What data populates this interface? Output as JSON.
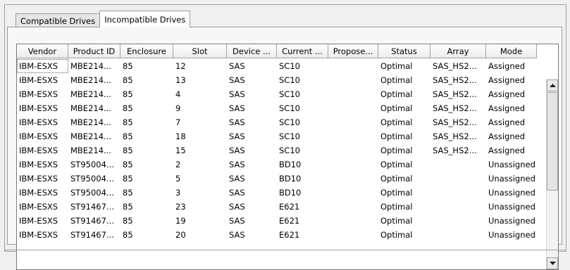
{
  "tabs": [
    {
      "label": "Compatible Drives",
      "active": false
    },
    {
      "label": "Incompatible Drives",
      "active": true
    }
  ],
  "table": {
    "columns": [
      "Vendor",
      "Product ID",
      "Enclosure",
      "Slot",
      "Device ...",
      "Current ...",
      "Propose...",
      "Status",
      "Array",
      "Mode"
    ],
    "rows": [
      [
        "IBM-ESXS",
        "MBE214...",
        "85",
        "12",
        "SAS",
        "SC10",
        "",
        "Optimal",
        "SAS_HS2...",
        "Assigned"
      ],
      [
        "IBM-ESXS",
        "MBE214...",
        "85",
        "13",
        "SAS",
        "SC10",
        "",
        "Optimal",
        "SAS_HS2...",
        "Assigned"
      ],
      [
        "IBM-ESXS",
        "MBE214...",
        "85",
        "4",
        "SAS",
        "SC10",
        "",
        "Optimal",
        "SAS_HS2...",
        "Assigned"
      ],
      [
        "IBM-ESXS",
        "MBE214...",
        "85",
        "9",
        "SAS",
        "SC10",
        "",
        "Optimal",
        "SAS_HS2...",
        "Assigned"
      ],
      [
        "IBM-ESXS",
        "MBE214...",
        "85",
        "7",
        "SAS",
        "SC10",
        "",
        "Optimal",
        "SAS_HS2...",
        "Assigned"
      ],
      [
        "IBM-ESXS",
        "MBE214...",
        "85",
        "18",
        "SAS",
        "SC10",
        "",
        "Optimal",
        "SAS_HS2...",
        "Assigned"
      ],
      [
        "IBM-ESXS",
        "MBE214...",
        "85",
        "15",
        "SAS",
        "SC10",
        "",
        "Optimal",
        "SAS_HS2...",
        "Assigned"
      ],
      [
        "IBM-ESXS",
        "ST95004...",
        "85",
        "2",
        "SAS",
        "BD10",
        "",
        "Optimal",
        "",
        "Unassigned"
      ],
      [
        "IBM-ESXS",
        "ST95004...",
        "85",
        "5",
        "SAS",
        "BD10",
        "",
        "Optimal",
        "",
        "Unassigned"
      ],
      [
        "IBM-ESXS",
        "ST95004...",
        "85",
        "3",
        "SAS",
        "BD10",
        "",
        "Optimal",
        "",
        "Unassigned"
      ],
      [
        "IBM-ESXS",
        "ST91467...",
        "85",
        "23",
        "SAS",
        "E621",
        "",
        "Optimal",
        "",
        "Unassigned"
      ],
      [
        "IBM-ESXS",
        "ST91467...",
        "85",
        "19",
        "SAS",
        "E621",
        "",
        "Optimal",
        "",
        "Unassigned"
      ],
      [
        "IBM-ESXS",
        "ST91467...",
        "85",
        "20",
        "SAS",
        "E621",
        "",
        "Optimal",
        "",
        "Unassigned"
      ]
    ]
  },
  "icons": {
    "scroll_up": "scroll-up-arrow-icon",
    "scroll_down": "scroll-down-arrow-icon"
  }
}
